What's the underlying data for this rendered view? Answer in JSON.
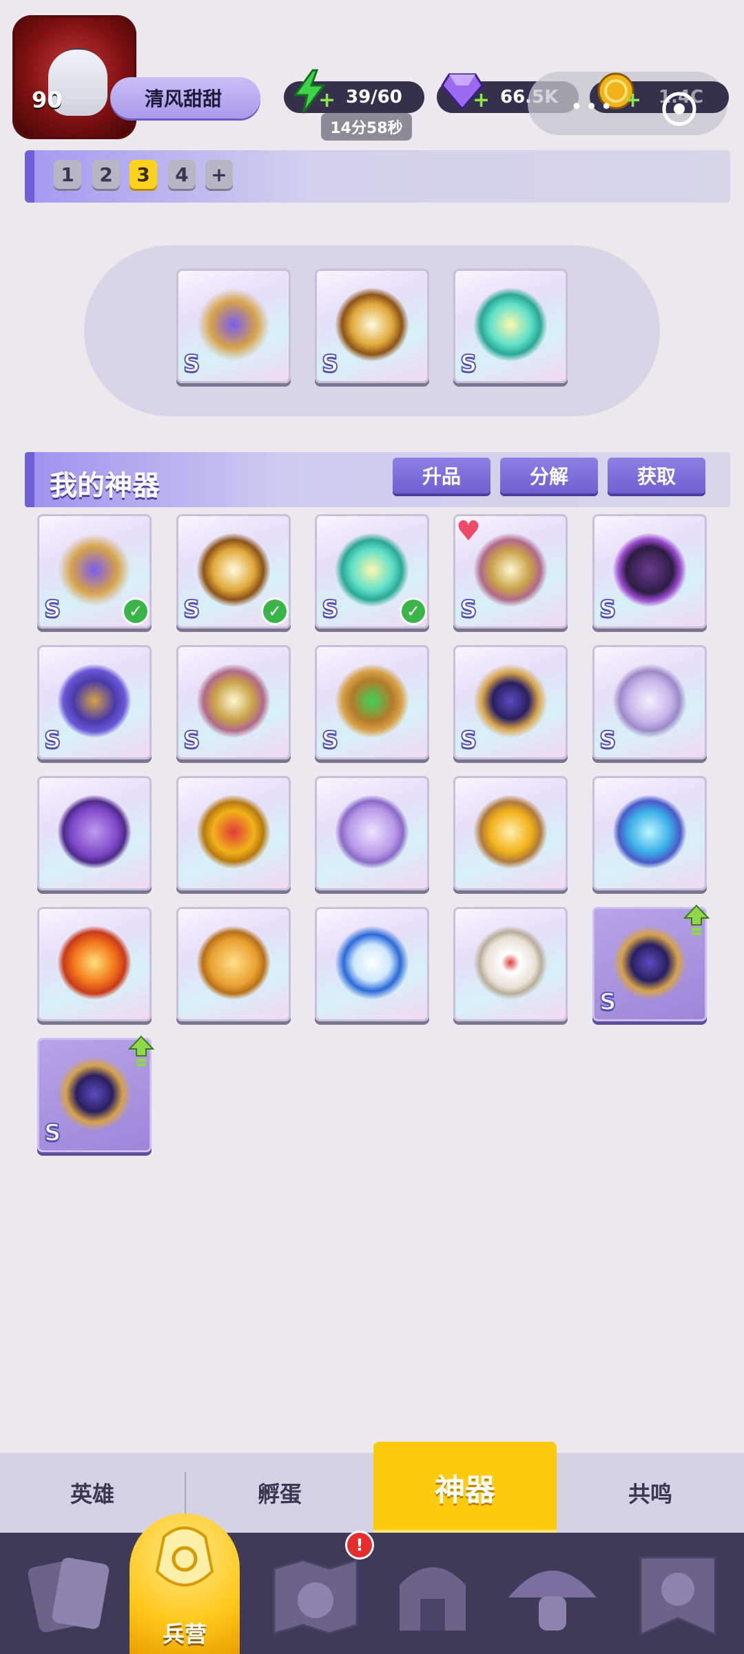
{
  "player": {
    "level": "90",
    "name": "清风甜甜"
  },
  "resources": {
    "energy": {
      "icon": "lightning-icon",
      "value": "39/60",
      "timer": "14分58秒"
    },
    "gems": {
      "icon": "diamond-icon",
      "value": "66.5K"
    },
    "gold": {
      "icon": "coin-icon",
      "value": "1.4C"
    }
  },
  "teams": {
    "slots": [
      "1",
      "2",
      "3",
      "4"
    ],
    "active": "3",
    "add_label": "+"
  },
  "equipped": [
    {
      "icon": "golden-staff-icon",
      "rank": "S"
    },
    {
      "icon": "golden-ring-icon",
      "rank": "S"
    },
    {
      "icon": "teal-scroll-icon",
      "rank": "S"
    }
  ],
  "artifacts_section": {
    "title": "我的神器",
    "buttons": {
      "upgrade": "升品",
      "dismantle": "分解",
      "obtain": "获取"
    }
  },
  "artifacts": [
    {
      "icon": "golden-staff-icon",
      "rank": "S",
      "status": "equipped"
    },
    {
      "icon": "golden-ring-icon",
      "rank": "S",
      "status": "equipped"
    },
    {
      "icon": "teal-scroll-icon",
      "rank": "S",
      "status": "equipped"
    },
    {
      "icon": "crossbow-sword-icon",
      "rank": "S",
      "status": "favorite"
    },
    {
      "icon": "dark-hood-icon",
      "rank": "S",
      "status": ""
    },
    {
      "icon": "purple-bird-icon",
      "rank": "S",
      "status": ""
    },
    {
      "icon": "crossbow-sword-icon",
      "rank": "S",
      "status": ""
    },
    {
      "icon": "emerald-wand-icon",
      "rank": "S",
      "status": ""
    },
    {
      "icon": "golden-bow-icon",
      "rank": "S",
      "status": ""
    },
    {
      "icon": "crystal-orb-icon",
      "rank": "S",
      "status": ""
    },
    {
      "icon": "purple-horn-icon",
      "rank": "",
      "status": ""
    },
    {
      "icon": "royal-crown-icon",
      "rank": "",
      "status": ""
    },
    {
      "icon": "lavender-pouch-icon",
      "rank": "",
      "status": ""
    },
    {
      "icon": "potion-bottle-icon",
      "rank": "",
      "status": ""
    },
    {
      "icon": "blue-flame-gauntlet-icon",
      "rank": "",
      "status": ""
    },
    {
      "icon": "fire-torch-icon",
      "rank": "",
      "status": ""
    },
    {
      "icon": "magic-scroll-icon",
      "rank": "",
      "status": ""
    },
    {
      "icon": "stopwatch-icon",
      "rank": "",
      "status": ""
    },
    {
      "icon": "dice-icon",
      "rank": "",
      "status": ""
    },
    {
      "icon": "golden-bow-icon",
      "rank": "S",
      "status": "upgradable"
    },
    {
      "icon": "golden-bow-icon",
      "rank": "S",
      "status": "upgradable"
    }
  ],
  "sub_tabs": [
    "英雄",
    "孵蛋",
    "神器",
    "共鸣"
  ],
  "active_sub_tab": "神器",
  "nav": {
    "items": [
      "cards-icon",
      "barracks-icon",
      "map-icon",
      "shop-icon",
      "mushroom-icon",
      "guild-banner-icon"
    ],
    "active_label": "兵营",
    "alert": "!"
  },
  "colors": {
    "accent": "#6f5fd9",
    "active_tab": "#ffcb0e",
    "nav_bg": "#3e3a58",
    "equipped_check": "#3ab54a",
    "upgrade_arrow": "#8fd84a"
  }
}
